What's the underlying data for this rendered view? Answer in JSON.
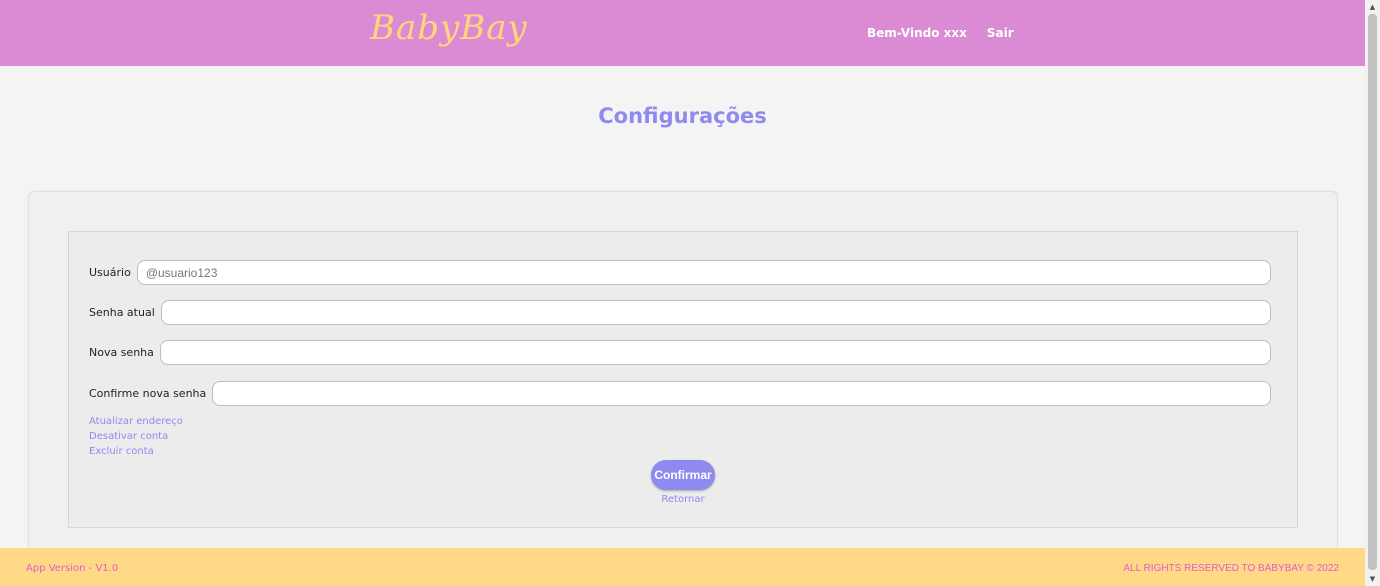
{
  "header": {
    "logo": "BabyBay",
    "welcome": "Bem-Vindo xxx",
    "logout": "Sair"
  },
  "page": {
    "title": "Configurações"
  },
  "form": {
    "fields": [
      {
        "label": "Usuário",
        "placeholder": "@usuario123",
        "value": ""
      },
      {
        "label": "Senha atual",
        "placeholder": "",
        "value": ""
      },
      {
        "label": "Nova senha",
        "placeholder": "",
        "value": ""
      },
      {
        "label": "Confirme nova senha",
        "placeholder": "",
        "value": ""
      }
    ],
    "links": [
      "Atualizar endereço",
      "Desativar conta",
      "Excluir conta"
    ],
    "confirm_label": "Confirmar",
    "return_label": "Retornar"
  },
  "footer": {
    "version": "App Version - V1.0",
    "rights": "ALL RIGHTS RESERVED TO BABYBAY © 2022"
  },
  "colors": {
    "header": "#da8bd4",
    "logo": "#ffd679",
    "accent": "#8f8af0",
    "footer": "#ffd986",
    "footer_text": "#e15ccf"
  },
  "icons": {
    "scroll_up": "arrow-up-icon",
    "scroll_down": "arrow-down-icon"
  }
}
